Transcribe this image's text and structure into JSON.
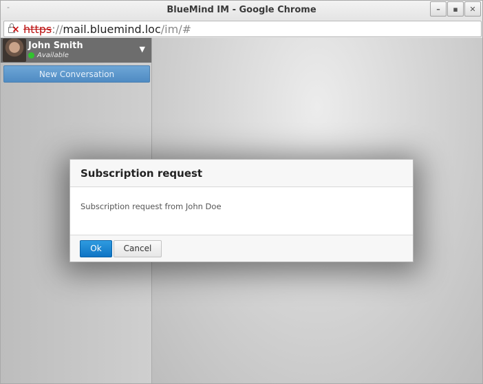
{
  "window": {
    "title": "BlueMind IM - Google Chrome",
    "menu_mark": "-",
    "minimize_glyph": "–",
    "maximize_glyph": "▪",
    "close_glyph": "✕"
  },
  "address_bar": {
    "scheme": "https",
    "separator": "://",
    "host": "mail.bluemind.loc",
    "path": "/im/#",
    "security_icon": "broken-lock-icon",
    "scheme_color": "#bb1111"
  },
  "sidebar": {
    "user": {
      "name": "John Smith",
      "status": "Available",
      "status_color": "#31c22e",
      "menu_caret": "▼"
    },
    "new_conversation_label": "New Conversation"
  },
  "dialog": {
    "title": "Subscription request",
    "message": "Subscription request from John Doe",
    "ok_label": "Ok",
    "cancel_label": "Cancel",
    "accent": "#0e74c4"
  }
}
